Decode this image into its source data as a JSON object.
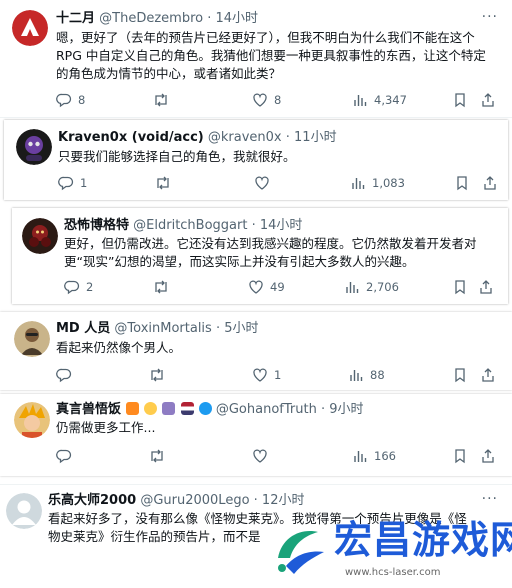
{
  "tweets": [
    {
      "name": "十二月",
      "handle": "@TheDezembro",
      "time": "· 14小时",
      "text_lines": [
        "嗯，更好了（去年的预告片已经更好了），但我不明白为什么我们不能在这个",
        "RPG 中自定义自己的角色。我猜他们想要一种更具叙事性的东西，让这个特定",
        "的角色成为情节的中心，或者诸如此类？"
      ],
      "replies": "8",
      "retweets": "",
      "likes": "8",
      "views": "4,347"
    },
    {
      "name": "Kraven0x (void/acc)",
      "handle": "@kraven0x",
      "time": "· 11小时",
      "text_lines": [
        "只要我们能够选择自己的角色，我就很好。"
      ],
      "replies": "1",
      "retweets": "",
      "likes": "",
      "views": "1,083"
    },
    {
      "name": "恐怖博格特",
      "handle": "@EldritchBoggart",
      "time": "· 14小时",
      "text_lines": [
        "更好，但仍需改进。它还没有达到我感兴趣的程度。它仍然散发着开发者对",
        "更“现实”幻想的渴望，而这实际上并没有引起大多数人的兴趣。"
      ],
      "replies": "2",
      "retweets": "",
      "likes": "49",
      "views": "2,706"
    },
    {
      "name": "MD 人员",
      "handle": "@ToxinMortalis",
      "time": "· 5小时",
      "text_lines": [
        "看起来仍然像个男人。"
      ],
      "replies": "",
      "retweets": "",
      "likes": "1",
      "views": "88"
    },
    {
      "name": "真言兽悟饭",
      "handle": "@GohanofTruth",
      "time": "· 9小时",
      "text_lines": [
        "仍需做更多工作..."
      ],
      "replies": "",
      "retweets": "",
      "likes": "",
      "views": "166"
    },
    {
      "name": "乐高大师2000",
      "handle": "@Guru2000Lego",
      "time": "· 12小时",
      "text_lines": [
        "看起来好多了，没有那么像《怪物史莱克》。我觉得第一个预告片更像是《怪",
        "物史莱克》衍生作品的预告片，而不是"
      ],
      "replies": "",
      "retweets": "",
      "likes": "",
      "views": ""
    }
  ],
  "more_label": "···",
  "watermark": {
    "text": "宏昌游戏网",
    "url": "www.hcs-laser.com"
  },
  "colors": {
    "icon": "#536471",
    "text": "#0f1419",
    "watermark": "#1e5bd8",
    "accent_green": "#1aa37a"
  }
}
